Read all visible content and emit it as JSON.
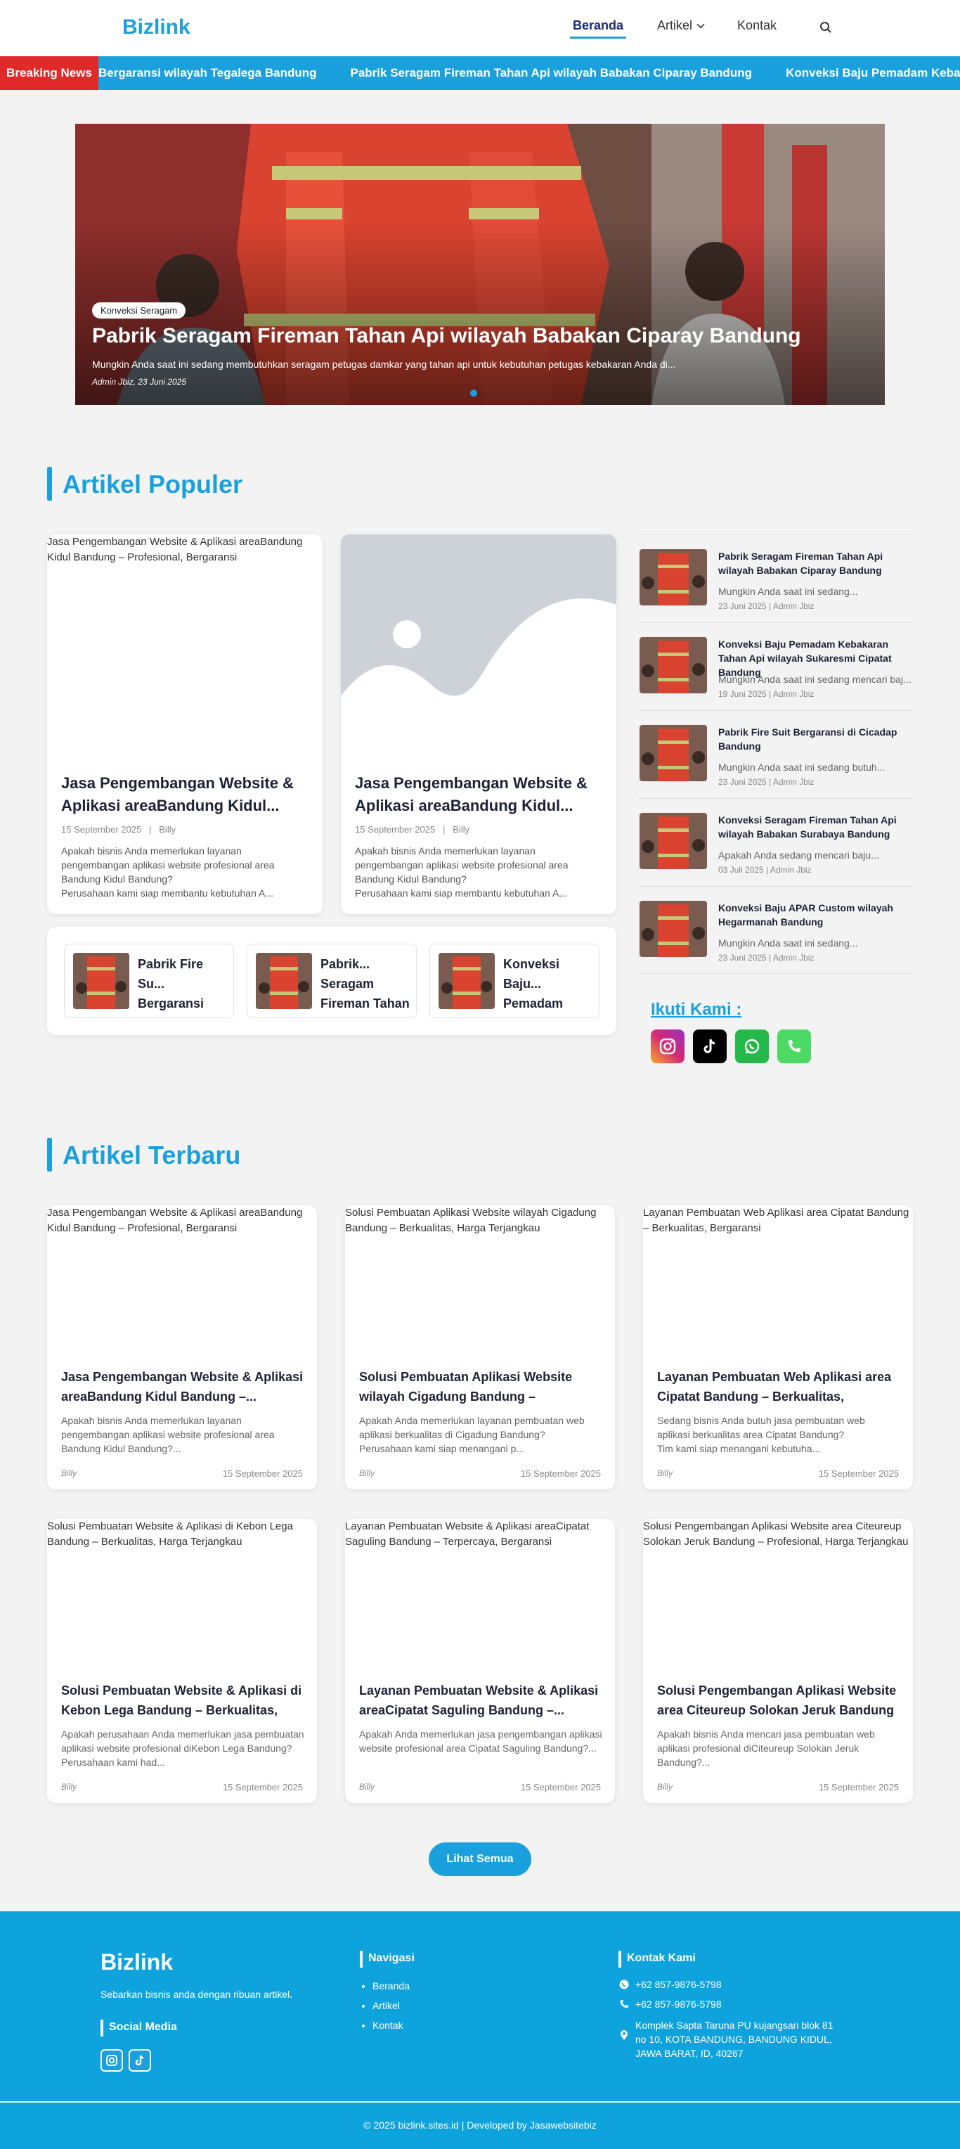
{
  "header": {
    "logo": "Bizlink",
    "nav": [
      "Beranda",
      "Artikel",
      "Kontak"
    ]
  },
  "ticker": {
    "label": "Breaking News",
    "items": [
      "Bergaransi wilayah Tegalega Bandung",
      "Pabrik Seragam Fireman Tahan Api wilayah Babakan Ciparay Bandung",
      "Konveksi Baju Pemadam Kebakaran Tahan Api wilayah"
    ]
  },
  "hero": {
    "badge": "Konveksi Seragam",
    "title": "Pabrik Seragam Fireman Tahan Api wilayah Babakan Ciparay Bandung",
    "excerpt": "Mungkin Anda saat ini sedang membutuhkan seragam petugas damkar yang tahan api untuk kebutuhan petugas kebakaran Anda di...",
    "meta": "Admin Jbiz, 23 Juni 2025"
  },
  "popular": {
    "title": "Artikel Populer",
    "cards": [
      {
        "alt": "Jasa Pengembangan Website & Aplikasi areaBandung Kidul Bandung – Profesional, Bergaransi",
        "title": "Jasa Pengembangan Website & Aplikasi areaBandung Kidul...",
        "date": "15 September 2025",
        "author": "Billy",
        "excerpt": "Apakah bisnis Anda memerlukan layanan pengembangan aplikasi website profesional area Bandung Kidul Bandung?\nPerusahaan kami siap membantu kebutuhan A..."
      },
      {
        "alt": "",
        "title": "Jasa Pengembangan Website & Aplikasi areaBandung Kidul...",
        "date": "15 September 2025",
        "author": "Billy",
        "excerpt": "Apakah bisnis Anda memerlukan layanan pengembangan aplikasi website profesional area Bandung Kidul Bandung?\nPerusahaan kami siap membantu kebutuhan A..."
      }
    ],
    "mini": [
      "Pabrik Fire Su... Bergaransi wilayah Tegaleg",
      "Pabrik... Seragam Fireman Tahan",
      "Konveksi Baju... Pemadam Kebakaran"
    ]
  },
  "sidebar": {
    "items": [
      {
        "title": "Pabrik Seragam Fireman Tahan Api wilayah Babakan Ciparay Bandung",
        "excerpt": "Mungkin Anda saat ini sedang...",
        "meta": "23 Juni 2025 | Admin Jbiz"
      },
      {
        "title": "Konveksi Baju Pemadam Kebakaran Tahan Api wilayah Sukaresmi Cipatat Bandung",
        "excerpt": "Mungkin Anda saat ini sedang mencari baj...",
        "meta": "19 Juni 2025 | Admin Jbiz"
      },
      {
        "title": "Pabrik Fire Suit Bergaransi di Cicadap Bandung",
        "excerpt": "Mungkin Anda saat ini sedang butuh...",
        "meta": "23 Juni 2025 | Admin Jbiz"
      },
      {
        "title": "Konveksi Seragam Fireman Tahan Api wilayah Babakan Surabaya Bandung",
        "excerpt": "Apakah Anda sedang mencari baju...",
        "meta": "03 Juli 2025 | Admin Jbiz"
      },
      {
        "title": "Konveksi Baju APAR Custom wilayah Hegarmanah Bandung",
        "excerpt": "Mungkin Anda saat ini sedang...",
        "meta": "23 Juni 2025 | Admin Jbiz"
      }
    ],
    "follow": "Ikuti Kami :",
    "social": [
      "instagram-icon",
      "tiktok-icon",
      "whatsapp-icon",
      "phone-icon"
    ],
    "social_colors": [
      "#d62976",
      "#000000",
      "#25b84a",
      "#4cd964"
    ]
  },
  "latest": {
    "title": "Artikel Terbaru",
    "cards": [
      {
        "alt": "Jasa Pengembangan Website & Aplikasi areaBandung Kidul Bandung – Profesional, Bergaransi",
        "title": "Jasa Pengembangan Website & Aplikasi areaBandung Kidul Bandung –...",
        "excerpt": "Apakah bisnis Anda memerlukan layanan pengembangan aplikasi website profesional area Bandung Kidul Bandung?...",
        "author": "Billy",
        "date": "15 September 2025"
      },
      {
        "alt": "Solusi Pembuatan Aplikasi Website wilayah Cigadung Bandung – Berkualitas, Harga Terjangkau",
        "title": "Solusi Pembuatan Aplikasi Website wilayah Cigadung Bandung – Berkualita...",
        "excerpt": "Apakah Anda memerlukan layanan pembuatan web aplikasi berkualitas di Cigadung Bandung?\nPerusahaan kami siap menangani p...",
        "author": "Billy",
        "date": "15 September 2025"
      },
      {
        "alt": "Layanan Pembuatan Web Aplikasi area Cipatat Bandung – Berkualitas, Bergaransi",
        "title": "Layanan Pembuatan Web Aplikasi area Cipatat Bandung – Berkualitas, Bergaransi",
        "excerpt": "Sedang bisnis Anda butuh jasa pembuatan web aplikasi berkualitas area Cipatat Bandung?\nTim kami siap menangani kebutuha...",
        "author": "Billy",
        "date": "15 September 2025"
      },
      {
        "alt": "Solusi Pembuatan Website & Aplikasi di Kebon Lega Bandung – Berkualitas, Harga Terjangkau",
        "title": "Solusi Pembuatan Website & Aplikasi di Kebon Lega Bandung – Berkualitas, Har...",
        "excerpt": "Apakah perusahaan Anda memerlukan jasa pembuatan aplikasi website profesional diKebon Lega Bandung?\nPerusahaan kami had...",
        "author": "Billy",
        "date": "15 September 2025"
      },
      {
        "alt": "Layanan Pembuatan Website & Aplikasi areaCipatat Saguling Bandung – Terpercaya, Bergaransi",
        "title": "Layanan Pembuatan Website & Aplikasi areaCipatat Saguling Bandung –...",
        "excerpt": "Apakah Anda memerlukan jasa pengembangan aplikasi website profesional area Cipatat Saguling Bandung?...",
        "author": "Billy",
        "date": "15 September 2025"
      },
      {
        "alt": "Solusi Pengembangan Aplikasi Website area Citeureup Solokan Jeruk Bandung – Profesional, Harga Terjangkau",
        "title": "Solusi Pengembangan Aplikasi Website area Citeureup Solokan Jeruk Bandung ...",
        "excerpt": "Apakah bisnis Anda mencari jasa pembuatan web aplikasi profesional diCiteureup Solokan Jeruk Bandung?...",
        "author": "Billy",
        "date": "15 September 2025"
      }
    ],
    "more": "Lihat Semua"
  },
  "footer": {
    "logo": "Bizlink",
    "tagline": "Sebarkan bisnis anda dengan ribuan artikel.",
    "social_title": "Social Media",
    "nav_title": "Navigasi",
    "nav": [
      "Beranda",
      "Artikel",
      "Kontak"
    ],
    "contact_title": "Kontak Kami",
    "whatsapp": "+62 857-9876-5798",
    "phone": "+62 857-9876-5798",
    "address": "Komplek Sapta Taruna PU kujangsari blok 81 no 10, KOTA BANDUNG, BANDUNG KIDUL, JAWA BARAT, ID, 40267",
    "copyright": "© 2025 bizlink.sites.id | Developed by Jasawebsitebiz"
  },
  "colors": {
    "accent": "#1aa0dc",
    "breaking": "#e02a2a",
    "footer": "#0fa3de"
  }
}
